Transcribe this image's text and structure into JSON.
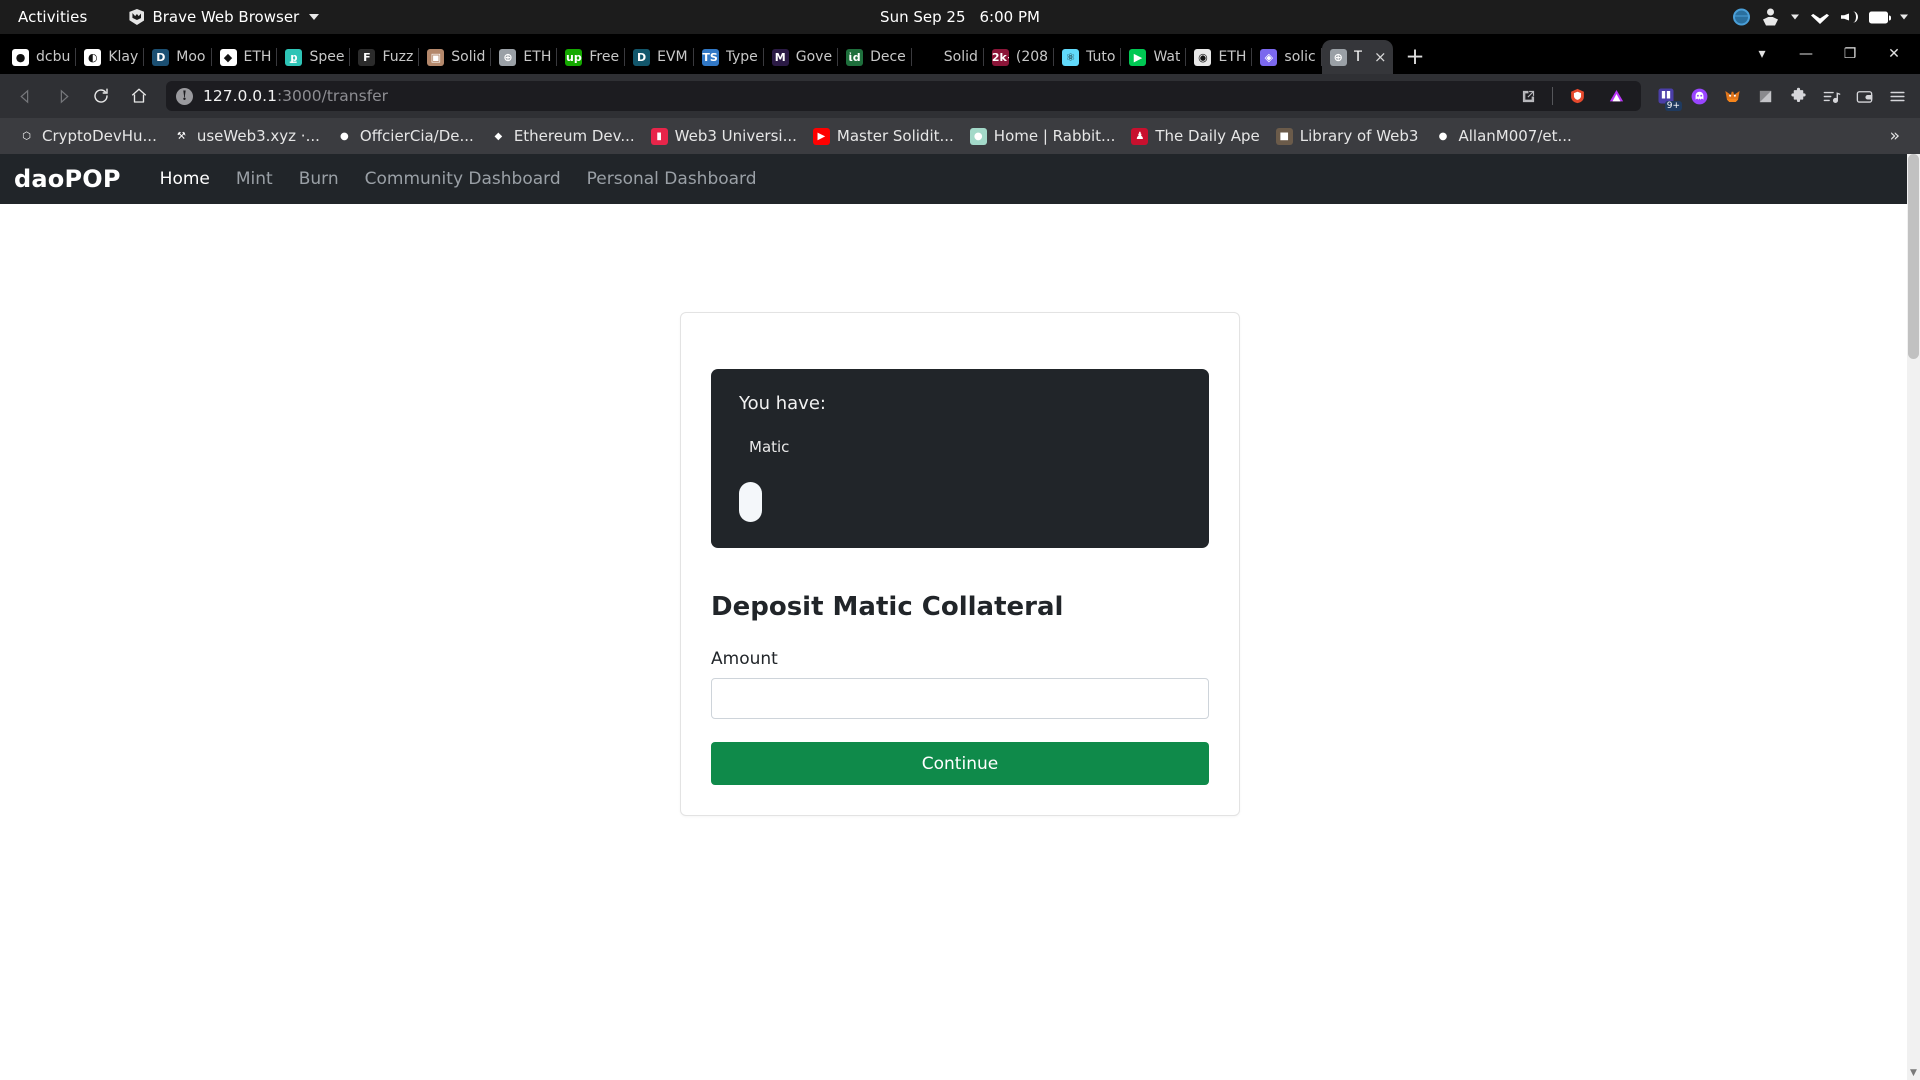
{
  "desktop": {
    "activities": "Activities",
    "app_name": "Brave Web Browser",
    "clock_date": "Sun Sep 25",
    "clock_time": "6:00 PM",
    "tray_icons": [
      "globe-icon",
      "accessibility-icon",
      "user-icon",
      "wifi-icon",
      "volume-icon",
      "battery-icon"
    ]
  },
  "browser": {
    "tabs": [
      {
        "title": "dcbu",
        "favicon": "github-icon",
        "color": "#ffffff",
        "glyph": "●",
        "active": false
      },
      {
        "title": "Klay",
        "favicon": "klaytn-icon",
        "color": "#ffffff",
        "glyph": "◐",
        "active": false
      },
      {
        "title": "Moo",
        "favicon": "moonbeam-icon",
        "color": "#1b4f72",
        "glyph": "D",
        "active": false
      },
      {
        "title": "ETH",
        "favicon": "ethereum-icon",
        "color": "#ffffff",
        "glyph": "◆",
        "active": false
      },
      {
        "title": "Spee",
        "favicon": "speedrun-icon",
        "color": "#2ec4b6",
        "glyph": "ք",
        "active": false
      },
      {
        "title": "Fuzz",
        "favicon": "fuzz-icon",
        "color": "#2b2b2b",
        "glyph": "F",
        "active": false
      },
      {
        "title": "Solid",
        "favicon": "solidity-photo-icon",
        "color": "#b4886b",
        "glyph": "▣",
        "active": false
      },
      {
        "title": "ETH",
        "favicon": "globe-grey-icon",
        "color": "#9aa0a6",
        "glyph": "⊕",
        "active": false
      },
      {
        "title": "Free",
        "favicon": "upwork-icon",
        "color": "#14a800",
        "glyph": "up",
        "active": false
      },
      {
        "title": "EVM",
        "favicon": "moonbeam-icon",
        "color": "#12566b",
        "glyph": "D",
        "active": false
      },
      {
        "title": "Type",
        "favicon": "typescript-icon",
        "color": "#3178c6",
        "glyph": "TS",
        "active": false
      },
      {
        "title": "Gove",
        "favicon": "moralis-icon",
        "color": "#2b1a45",
        "glyph": "M",
        "active": false
      },
      {
        "title": "Dece",
        "favicon": "earth-icon",
        "color": "#1e6f3c",
        "glyph": "ἰd",
        "active": false
      },
      {
        "title": "Solid",
        "favicon": "blank-icon",
        "color": "#000000",
        "glyph": "",
        "active": false
      },
      {
        "title": "(208",
        "favicon": "2k-plus-icon",
        "color": "#8b1538",
        "glyph": "2k+",
        "active": false
      },
      {
        "title": "Tuto",
        "favicon": "react-icon",
        "color": "#61dafb",
        "glyph": "⚛",
        "active": false
      },
      {
        "title": "Wat",
        "favicon": "youtube-play-icon",
        "color": "#00c853",
        "glyph": "▶",
        "active": false
      },
      {
        "title": "ETH",
        "favicon": "rainbow-icon",
        "color": "#e8e8e8",
        "glyph": "◉",
        "active": false
      },
      {
        "title": "solic",
        "favicon": "diamond-icon",
        "color": "#7b68ee",
        "glyph": "◈",
        "active": false
      },
      {
        "title": "T",
        "favicon": "globe-grey-icon",
        "color": "#9aa0a6",
        "glyph": "⊕",
        "active": true
      }
    ],
    "new_tab_label": "+",
    "close_tab_label": "×",
    "window_controls": {
      "minimize": "—",
      "maximize": "❐",
      "close": "✕",
      "tab_search": "▾"
    },
    "toolbar": {
      "back": "back-icon",
      "forward": "forward-icon",
      "reload": "reload-icon",
      "home": "home-icon",
      "bookmark": "bookmark-icon"
    },
    "url": {
      "host": "127.0.0.1",
      "path": ":3000/transfer",
      "security_glyph": "!"
    },
    "url_right_icons": [
      "open-external-icon",
      "brave-shields-icon",
      "brave-rewards-icon"
    ],
    "extension_icons": [
      "reading-list-icon",
      "ghost-wallet-icon",
      "metamask-icon",
      "blank-extension-icon",
      "extensions-puzzle-icon",
      "playlist-icon",
      "brave-wallet-icon",
      "menu-icon"
    ],
    "extension_badge": "9+",
    "bookmarks": [
      {
        "label": "CryptoDevHu...",
        "favicon": "cube-icon",
        "color": "#3b3c40",
        "glyph": "⬡"
      },
      {
        "label": "useWeb3.xyz ·...",
        "favicon": "tools-icon",
        "color": "#3b3c40",
        "glyph": "⚒"
      },
      {
        "label": "OffcierCia/De...",
        "favicon": "github-icon",
        "color": "#3b3c40",
        "glyph": "●"
      },
      {
        "label": "Ethereum Dev...",
        "favicon": "ethereum-icon",
        "color": "#3b3c40",
        "glyph": "◆"
      },
      {
        "label": "Web3 Universi...",
        "favicon": "web3university-icon",
        "color": "#e8254a",
        "glyph": "▮"
      },
      {
        "label": "Master Solidit...",
        "favicon": "youtube-icon",
        "color": "#ff0000",
        "glyph": "▶"
      },
      {
        "label": "Home | Rabbit...",
        "favicon": "rabbit-icon",
        "color": "#a3d9c9",
        "glyph": "●"
      },
      {
        "label": "The Daily Ape",
        "favicon": "ape-icon",
        "color": "#c8102e",
        "glyph": "♟"
      },
      {
        "label": "Library of Web3",
        "favicon": "portrait-icon",
        "color": "#6b5b4a",
        "glyph": "■"
      },
      {
        "label": "AllanM007/et...",
        "favicon": "github-icon",
        "color": "#3b3c40",
        "glyph": "●"
      }
    ],
    "bookmarks_overflow": "»"
  },
  "app": {
    "brand": "daoPOP",
    "nav_links": [
      {
        "label": "Home",
        "active": true
      },
      {
        "label": "Mint",
        "active": false
      },
      {
        "label": "Burn",
        "active": false
      },
      {
        "label": "Community Dashboard",
        "active": false
      },
      {
        "label": "Personal Dashboard",
        "active": false
      }
    ],
    "balance": {
      "title": "You have:",
      "token": "Matic"
    },
    "form": {
      "title": "Deposit Matic Collateral",
      "amount_label": "Amount",
      "amount_value": "",
      "amount_placeholder": "",
      "submit_label": "Continue"
    },
    "colors": {
      "dark_panel": "#212529",
      "accent_green": "#0f8a4a",
      "page_bg": "#ffffff"
    }
  }
}
